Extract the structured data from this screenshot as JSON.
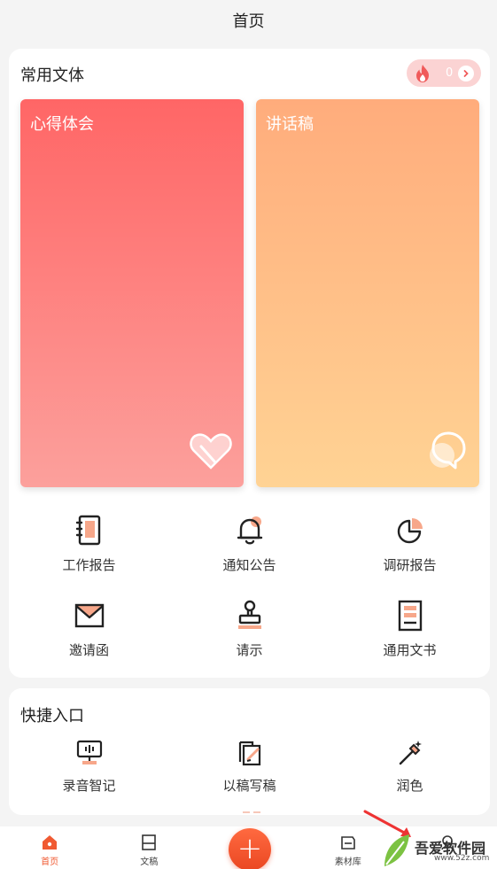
{
  "header": {
    "title": "首页"
  },
  "common": {
    "title": "常用文体",
    "badge_count": "0",
    "cards": [
      {
        "label": "心得体会"
      },
      {
        "label": "讲话稿"
      }
    ],
    "grid": [
      {
        "label": "工作报告",
        "icon": "notebook-icon"
      },
      {
        "label": "通知公告",
        "icon": "bell-icon"
      },
      {
        "label": "调研报告",
        "icon": "pie-chart-icon"
      },
      {
        "label": "邀请函",
        "icon": "envelope-icon"
      },
      {
        "label": "请示",
        "icon": "stamp-icon"
      },
      {
        "label": "通用文书",
        "icon": "document-icon"
      }
    ]
  },
  "quick": {
    "title": "快捷入口",
    "items": [
      {
        "label": "录音智记",
        "icon": "voice-recorder-icon"
      },
      {
        "label": "以稿写稿",
        "icon": "copy-edit-icon"
      },
      {
        "label": "润色",
        "icon": "magic-pen-icon"
      }
    ]
  },
  "tabbar": {
    "items": [
      {
        "label": "首页",
        "icon": "home-icon",
        "active": true
      },
      {
        "label": "文稿",
        "icon": "manuscript-icon"
      },
      {
        "label": "",
        "icon": "plus-icon"
      },
      {
        "label": "素材库",
        "icon": "library-icon"
      },
      {
        "label": "",
        "icon": "profile-icon"
      }
    ]
  },
  "watermark": {
    "name": "吾爱软件园",
    "url": "www.52z.com"
  },
  "colors": {
    "accent": "#f05a32",
    "card_left": "#ff6666",
    "card_right": "#ffac7c"
  }
}
